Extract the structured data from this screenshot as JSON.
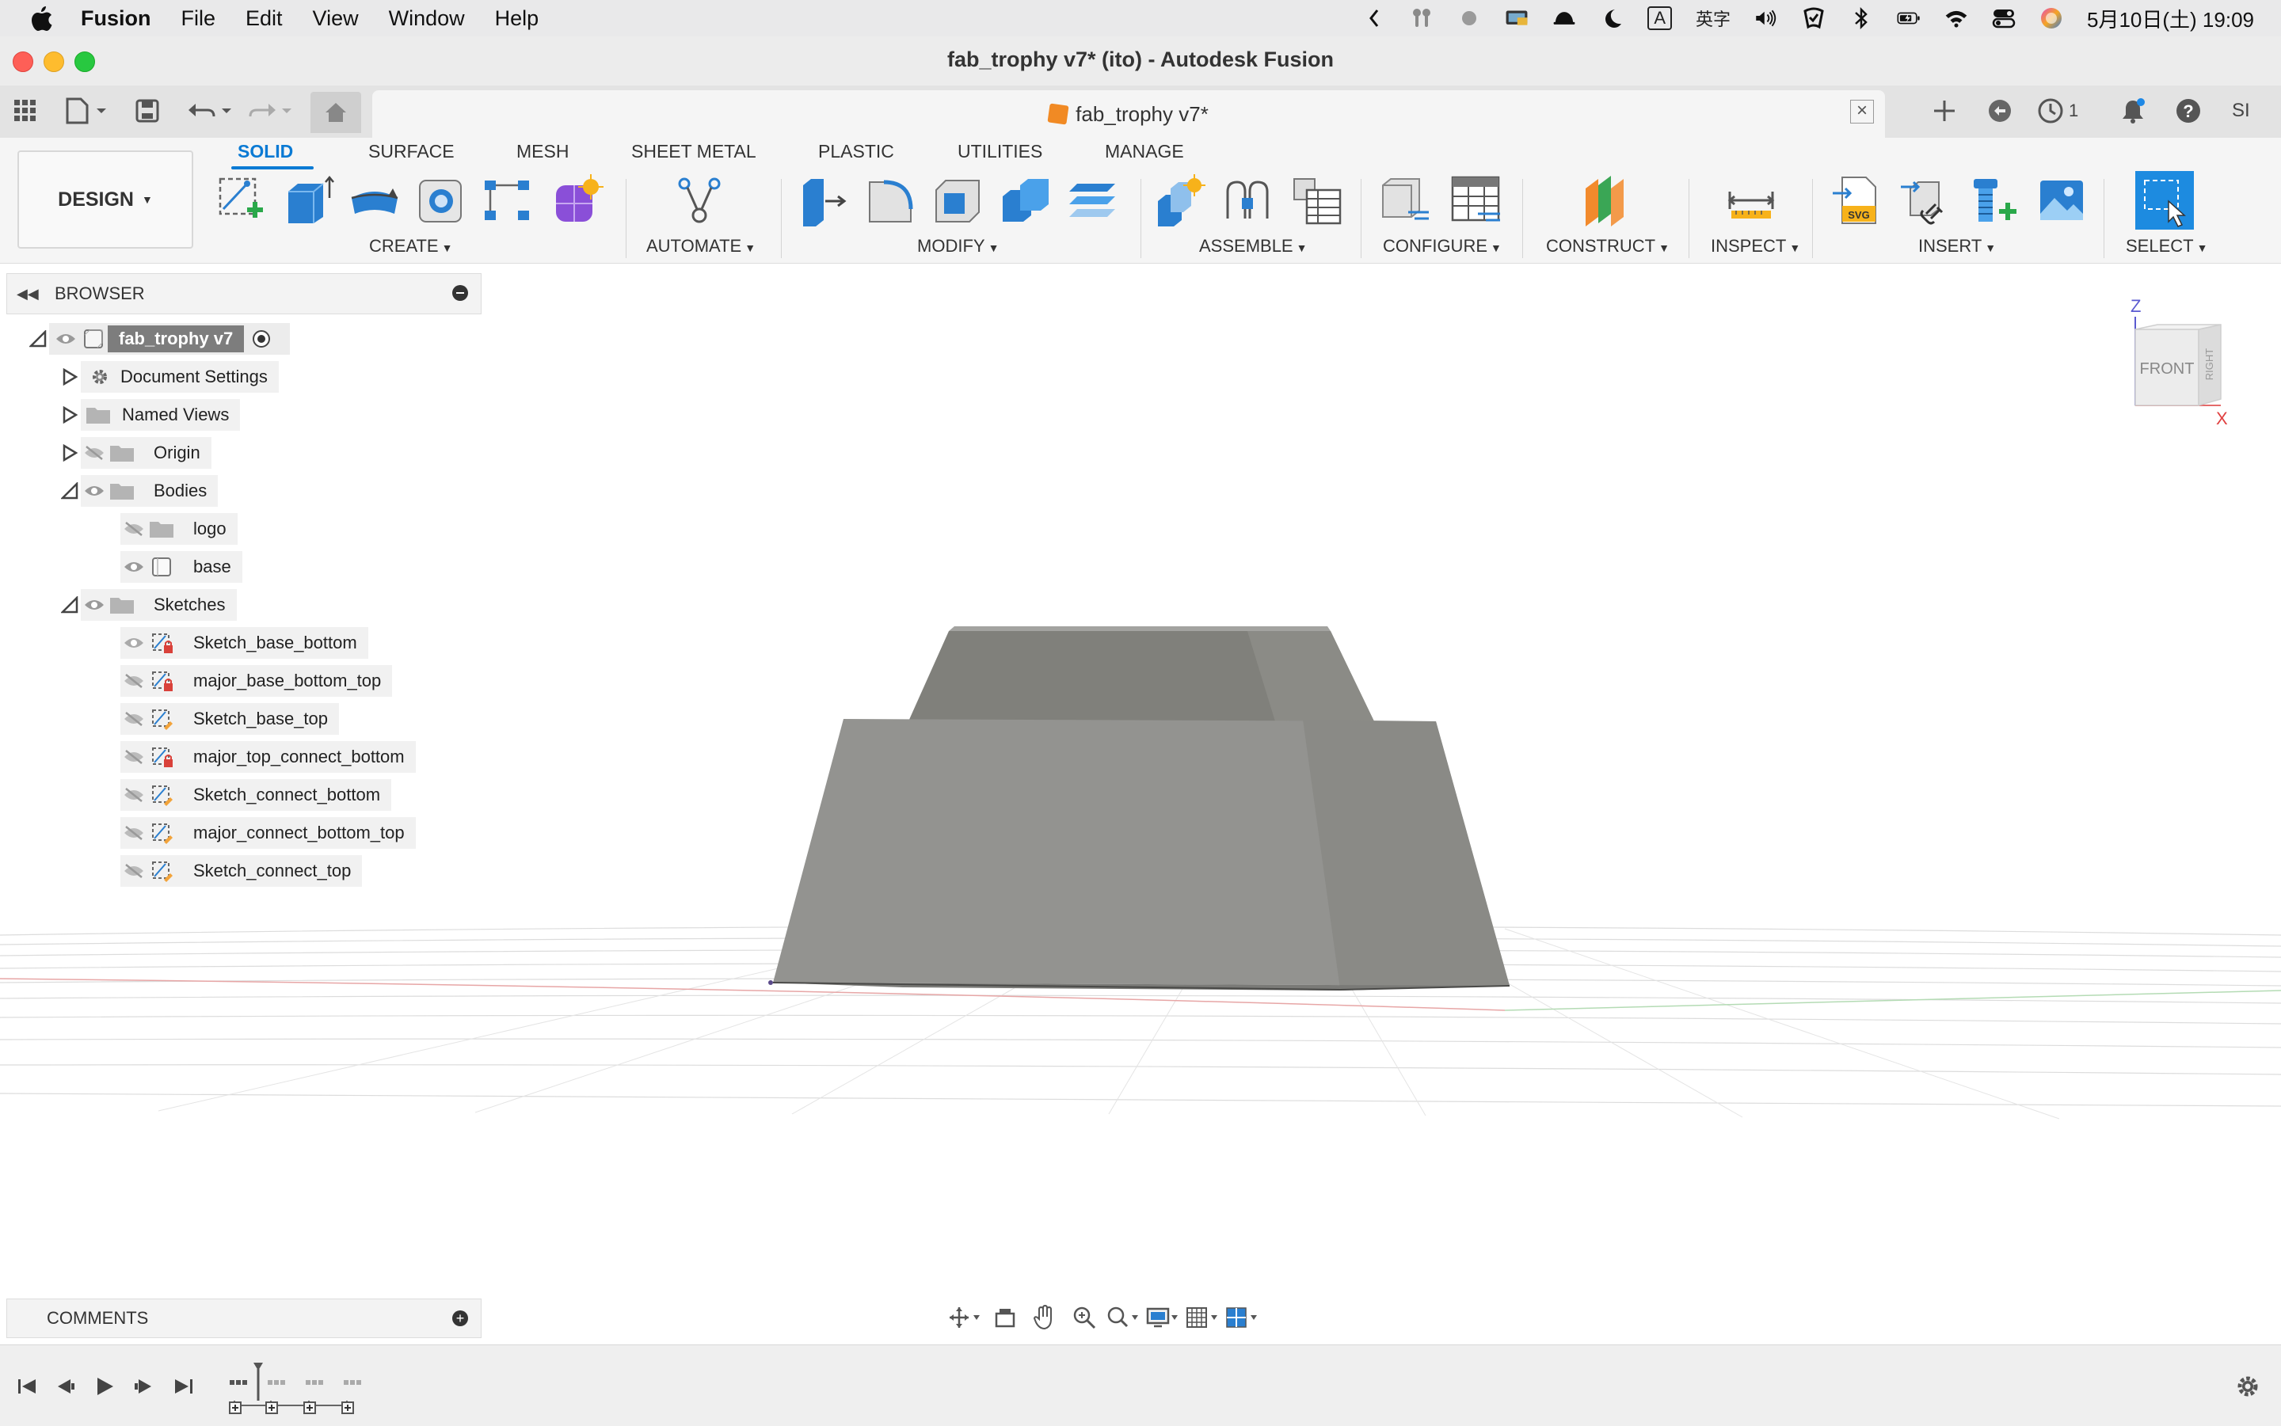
{
  "menubar": {
    "app": "Fusion",
    "items": [
      "File",
      "Edit",
      "View",
      "Window",
      "Help"
    ],
    "ime_label": "A",
    "ime_mode": "英字",
    "datetime": "5月10日(土)  19:09"
  },
  "window": {
    "title": "fab_trophy v7* (ito) - Autodesk Fusion"
  },
  "tabbar": {
    "doc_tab": "fab_trophy v7*",
    "job_count": "1",
    "user_initials": "SI"
  },
  "toolbar": {
    "workspace": "DESIGN",
    "tabs": [
      "SOLID",
      "SURFACE",
      "MESH",
      "SHEET METAL",
      "PLASTIC",
      "UTILITIES",
      "MANAGE"
    ],
    "groups": [
      "CREATE",
      "AUTOMATE",
      "MODIFY",
      "ASSEMBLE",
      "CONFIGURE",
      "CONSTRUCT",
      "INSPECT",
      "INSERT",
      "SELECT"
    ]
  },
  "browser": {
    "title": "BROWSER",
    "root": "fab_trophy v7",
    "items": [
      {
        "label": "Document Settings"
      },
      {
        "label": "Named Views"
      },
      {
        "label": "Origin"
      },
      {
        "label": "Bodies"
      },
      {
        "label": "logo"
      },
      {
        "label": "base"
      },
      {
        "label": "Sketches"
      },
      {
        "label": "Sketch_base_bottom"
      },
      {
        "label": "major_base_bottom_top"
      },
      {
        "label": "Sketch_base_top"
      },
      {
        "label": "major_top_connect_bottom"
      },
      {
        "label": "Sketch_connect_bottom"
      },
      {
        "label": "major_connect_bottom_top"
      },
      {
        "label": "Sketch_connect_top"
      }
    ]
  },
  "viewcube": {
    "axis_z": "Z",
    "axis_x": "X",
    "front": "FRONT",
    "right": "RIGHT"
  },
  "comments": {
    "title": "COMMENTS"
  },
  "colors": {
    "accent": "#0a7ad4",
    "body_gray": "#8d8d89",
    "menubar_bg": "#e9e9ea"
  }
}
